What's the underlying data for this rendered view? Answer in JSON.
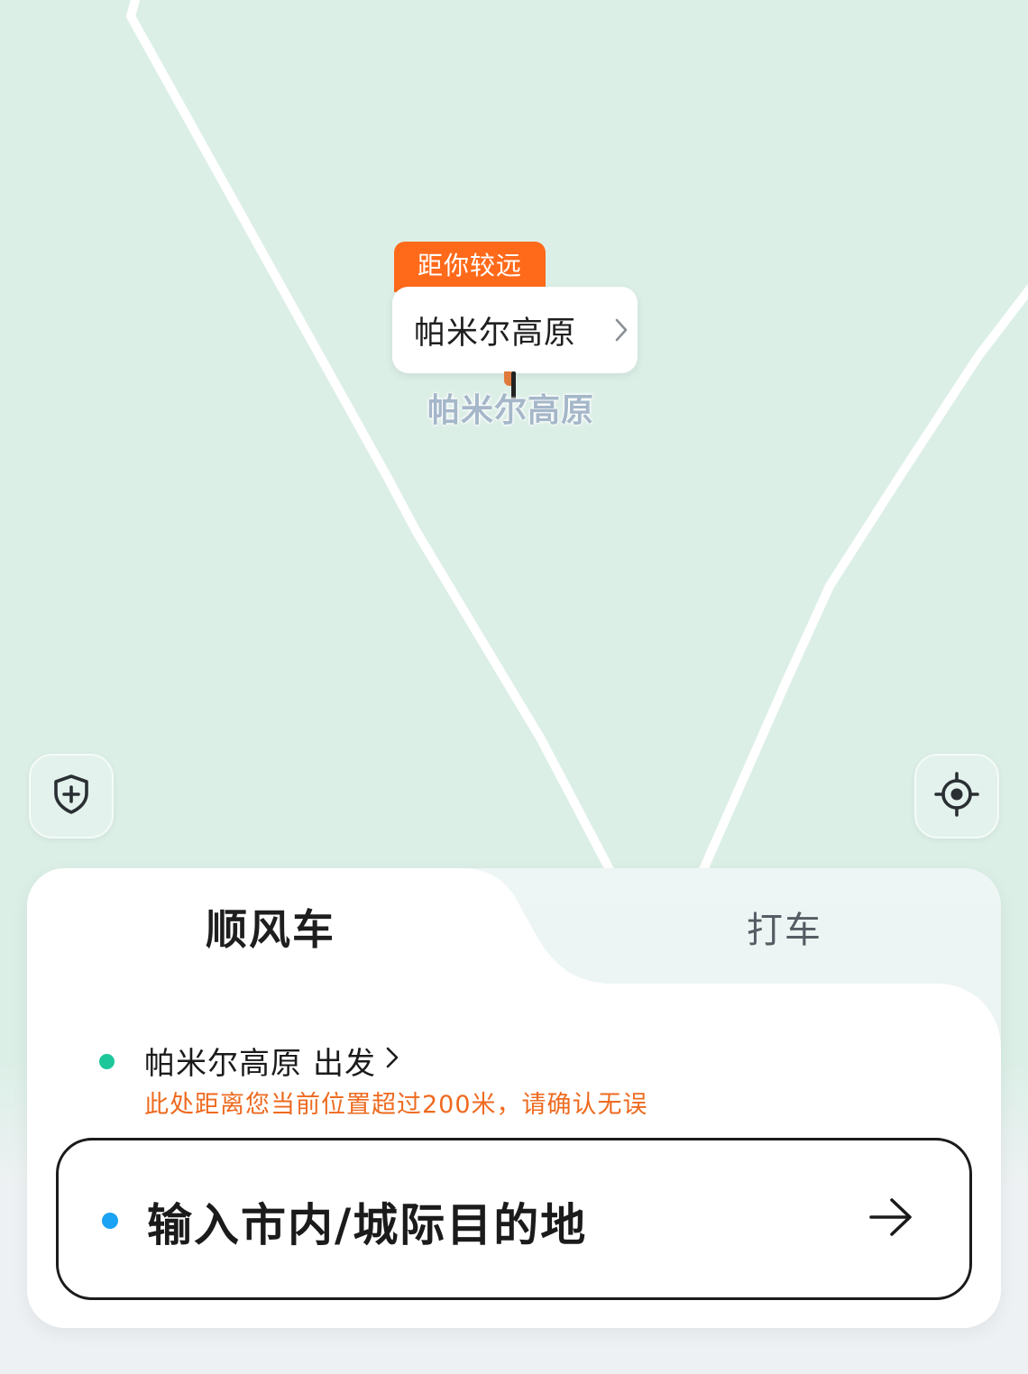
{
  "map": {
    "callout_badge": "距你较远",
    "callout_name": "帕米尔高原",
    "place_label": "帕米尔高原",
    "colors": {
      "land": "#dcefe7",
      "road": "#ffffff",
      "badge": "#ff6a1a",
      "place_label": "#a5b7c9"
    }
  },
  "controls": {
    "safety_icon": "shield-plus-icon",
    "locate_icon": "crosshair-locate-icon"
  },
  "tabs": [
    {
      "label": "顺风车",
      "active": true
    },
    {
      "label": "打车",
      "active": false
    }
  ],
  "origin": {
    "place": "帕米尔高原",
    "action": "出发",
    "warning": "此处距离您当前位置超过200米，请确认无误",
    "dot_color": "#1dc79a",
    "warning_color": "#ee6a1f"
  },
  "destination": {
    "placeholder": "输入市内/城际目的地",
    "dot_color": "#1aa3f4",
    "arrow_icon": "arrow-right-icon"
  }
}
